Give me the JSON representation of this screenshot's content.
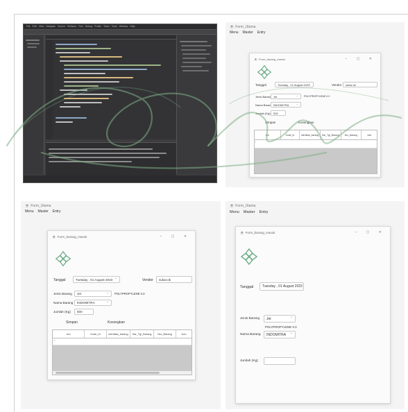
{
  "ide": {
    "menu_items": [
      "File",
      "Edit",
      "View",
      "Navigate",
      "Source",
      "Refactor",
      "Run",
      "Debug",
      "Profile",
      "Team",
      "Tools",
      "Window",
      "Help"
    ]
  },
  "tr": {
    "app_title": "Form_Utama",
    "menu": [
      "Menu",
      "Master",
      "Entry"
    ],
    "window_title": "Form_barang_masuk",
    "tanggal_label": "Tanggal",
    "tanggal_value": "Tuesday , 01 August 2023",
    "vendor_label": "Vendor",
    "vendor_value": "sukar.ok",
    "jenis_label": "Jenis Barang",
    "jenis_value": "Jet",
    "jenis_extra": "POLYPROPYLENE 0.3",
    "nama_label": "Nama Barang",
    "nama_value": "INDOMITRA",
    "jumlah_label": "Jumlah (Kg)",
    "jumlah_value": "500",
    "btn_simpan": "Simpan",
    "btn_kosongkan": "Kosongkan",
    "columns": [
      "Jen",
      "Kode_Id",
      "Identitas_barang",
      "Har_Tgl_Barang",
      "Nro_Barang",
      "Jum"
    ]
  },
  "bl": {
    "app_title": "Form_Utama",
    "menu": [
      "Menu",
      "Master",
      "Entry"
    ],
    "window_title": "Form_barang_masuk",
    "tanggal_label": "Tanggal",
    "tanggal_value": "Tuesday , 01 August 2023",
    "vendor_label": "Vendor",
    "vendor_value": "sukar.ok",
    "jenis_label": "Jenis Barang",
    "jenis_value": "Jet",
    "jenis_extra": "POLYPROPYLENE 0.3",
    "nama_label": "Nama Barang",
    "nama_value": "INDOMITRA",
    "jumlah_label": "Jumlah (Kg)",
    "jumlah_value": "500",
    "btn_simpan": "Simpan",
    "btn_kosongkan": "Kosongkan",
    "columns": [
      "Jen",
      "Kode_Id",
      "Identitas_barang",
      "Har_Tgl_Barang",
      "Nro_Barang",
      "Jum"
    ]
  },
  "br": {
    "app_title": "Form_Utama",
    "menu": [
      "Menu",
      "Master",
      "Entry"
    ],
    "window_title": "Form_barang_masuk",
    "tanggal_label": "Tanggal",
    "tanggal_value": "Tuesday , 01 August 2023",
    "jenis_label": "Jenis Barang",
    "jenis_value": "Jet",
    "jenis_extra": "POLYPROPYLENE 0.3",
    "nama_label": "Nama Barang",
    "nama_value": "INDOMITRA",
    "jumlah_label": "Jumlah (Kg)",
    "jumlah_value": ""
  },
  "colors": {
    "ide_bg": "#3d3d3f",
    "logo_green": "#6fae8a",
    "watermark_green": "#7fae86"
  }
}
